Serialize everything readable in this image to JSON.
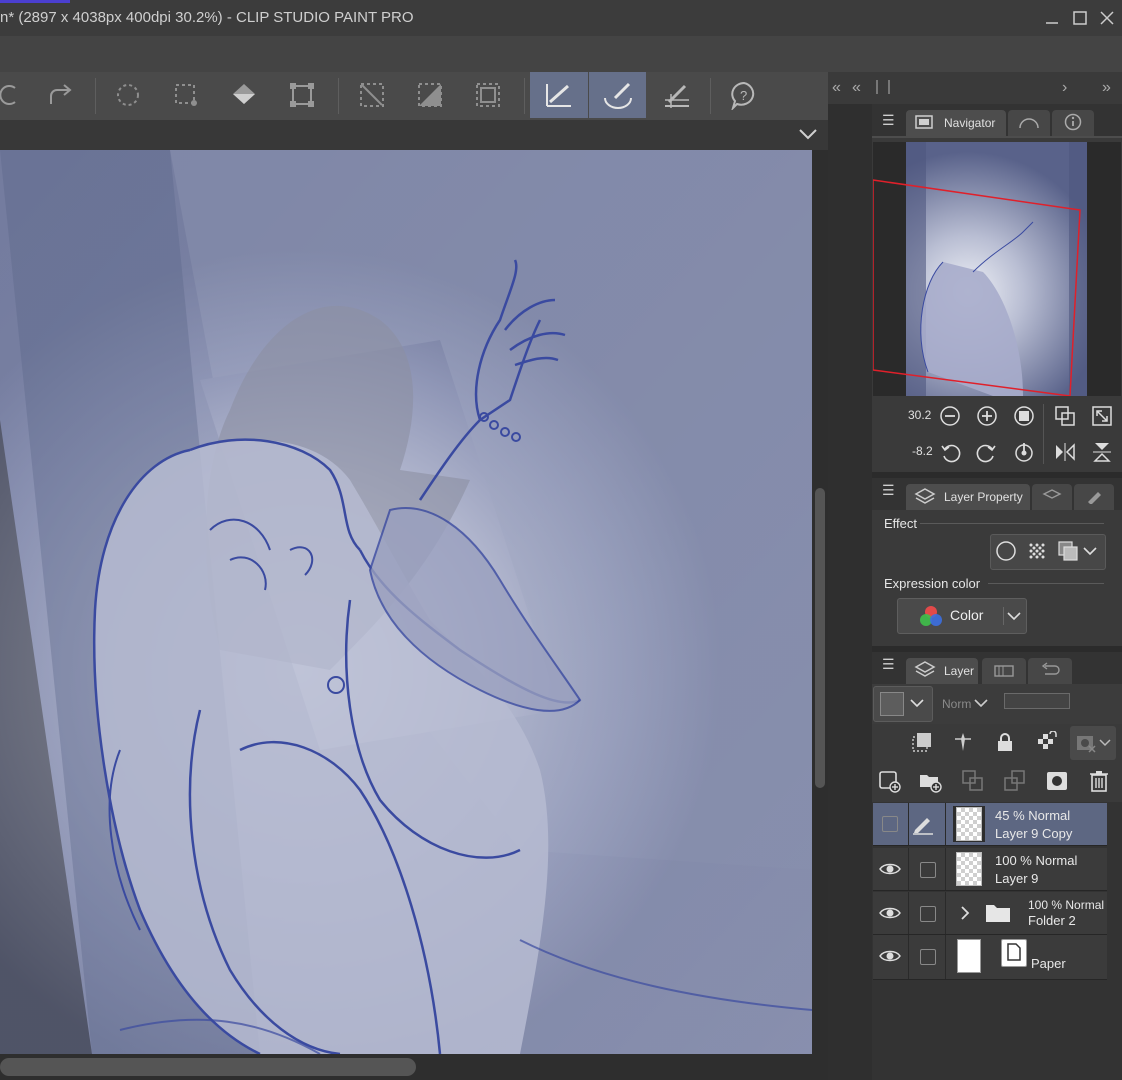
{
  "window": {
    "title": "n* (2897 x 4038px 400dpi 30.2%)  - CLIP STUDIO PAINT PRO",
    "controls": [
      "minimize",
      "maximize",
      "close"
    ]
  },
  "toolbar": {
    "items": [
      "undo-icon",
      "redo-icon",
      "clear-selection-icon",
      "deselect-icon",
      "fill-icon",
      "transform-icon",
      "hide-selection-icon",
      "show-selection-icon",
      "selection-border-icon",
      "snap-ruler-icon",
      "snap-special-ruler-icon",
      "snap-grid-icon",
      "help-icon"
    ],
    "active": [
      "snap-ruler-icon",
      "snap-special-ruler-icon"
    ],
    "active_color": "#66708a"
  },
  "navigator": {
    "tab_label": "Navigator",
    "zoom_value": "30.2",
    "rotate_value": "-8.2"
  },
  "layer_property": {
    "tab_label": "Layer Property",
    "effect_label": "Effect",
    "expression_color_label": "Expression color",
    "expression_color_value": "Color"
  },
  "layer_panel": {
    "tab_label": "Layer",
    "blend_mode": "Norm",
    "layers": [
      {
        "opacity_mode": "45 % Normal",
        "name": "Layer 9 Copy",
        "visible": false,
        "selected": true,
        "type": "raster"
      },
      {
        "opacity_mode": "100 % Normal",
        "name": "Layer 9",
        "visible": true,
        "selected": false,
        "type": "raster"
      },
      {
        "opacity_mode": "100 % Normal",
        "name": "Folder 2",
        "visible": true,
        "selected": false,
        "type": "folder"
      },
      {
        "opacity_mode": "",
        "name": "Paper",
        "visible": true,
        "selected": false,
        "type": "paper"
      }
    ]
  },
  "colors": {
    "titlebar": "#3c3c3c",
    "panel": "#3a3a3a",
    "selected_layer": "#5d6782",
    "canvas_tint": "#7f88a8",
    "navigator_frame": "#e0202a"
  }
}
